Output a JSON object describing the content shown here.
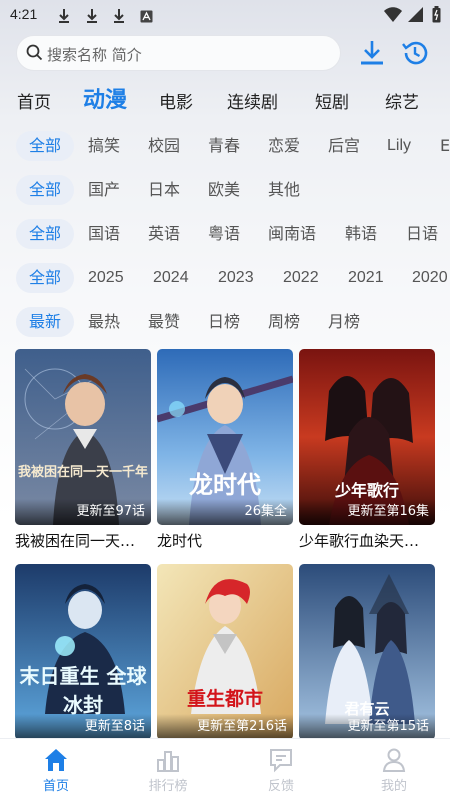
{
  "status": {
    "time": "4:21"
  },
  "search": {
    "placeholder": "搜索名称 简介"
  },
  "main_tabs": [
    "首页",
    "动漫",
    "电影",
    "连续剧",
    "短剧",
    "综艺"
  ],
  "filters": {
    "genre": [
      "全部",
      "搞笑",
      "校园",
      "青春",
      "恋爱",
      "后宫",
      "Lily",
      "E"
    ],
    "region": [
      "全部",
      "国产",
      "日本",
      "欧美",
      "其他"
    ],
    "language": [
      "全部",
      "国语",
      "英语",
      "粤语",
      "闽南语",
      "韩语",
      "日语"
    ],
    "year": [
      "全部",
      "2025",
      "2024",
      "2023",
      "2022",
      "2021",
      "2020"
    ],
    "sort": [
      "最新",
      "最热",
      "最赞",
      "日榜",
      "周榜",
      "月榜"
    ]
  },
  "cards": [
    {
      "title": "我被困在同一天…",
      "badge": "更新至97话",
      "art": "我被困在同一天一千年"
    },
    {
      "title": "龙时代",
      "badge": "26集全",
      "art": "龙时代"
    },
    {
      "title": "少年歌行血染天…",
      "badge": "更新至第16集",
      "art": "少年歌行"
    },
    {
      "title": "",
      "badge": "更新至8话",
      "art": "末日重生 全球冰封"
    },
    {
      "title": "",
      "badge": "更新至第216话",
      "art": "重生都市"
    },
    {
      "title": "",
      "badge": "更新至第15话",
      "art": "君有云"
    }
  ],
  "bottom_nav": [
    "首页",
    "排行榜",
    "反馈",
    "我的"
  ],
  "colors": {
    "accent": "#1e7fe6",
    "chip_bg": "#e9eef7",
    "inactive": "#c0c4cc"
  }
}
